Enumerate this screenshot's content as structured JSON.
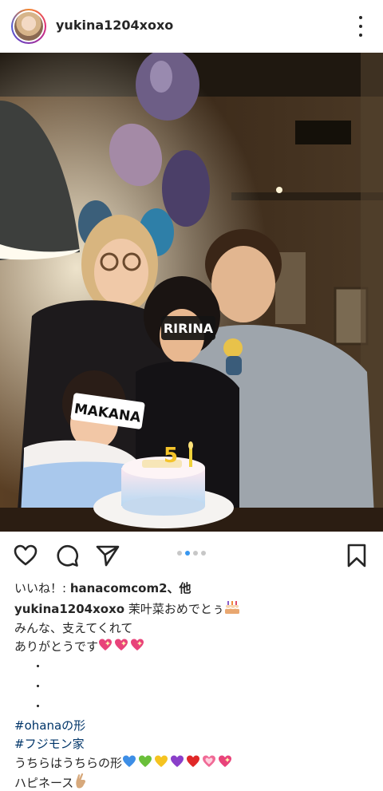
{
  "post": {
    "username": "yukina1204xoxo",
    "likes_prefix": "いいね！: ",
    "likes_user": "hanacomcom2",
    "likes_suffix": "、他",
    "caption_user": "yukina1204xoxo",
    "caption_lines": [
      "茉叶菜おめでとぅ",
      "みんな、支えてくれて",
      "ありがとうです"
    ],
    "bullets": [
      "・",
      "・",
      "・"
    ],
    "hashtags": [
      "#ohanaの形",
      "#フジモン家"
    ],
    "closing_lines": [
      "うちらはうちらの形",
      "ハピネース"
    ]
  },
  "photo": {
    "sticker_ririna": "RIRINA",
    "sticker_makana": "MAKANA",
    "cake_number": "5"
  },
  "carousel": {
    "count": 4,
    "active_index": 1
  },
  "icons": {
    "avatar": "profile-avatar",
    "more": "more-options-icon",
    "like": "heart-icon",
    "comment": "comment-icon",
    "share": "paper-plane-icon",
    "save": "bookmark-icon",
    "cake_emoji": "birthday-cake-emoji",
    "sparkle_heart": "sparkling-heart-emoji",
    "hand": "crossed-fingers-emoji"
  },
  "colors": {
    "hashtag": "#003569",
    "carousel_active": "#3897f0",
    "text": "#262626"
  }
}
